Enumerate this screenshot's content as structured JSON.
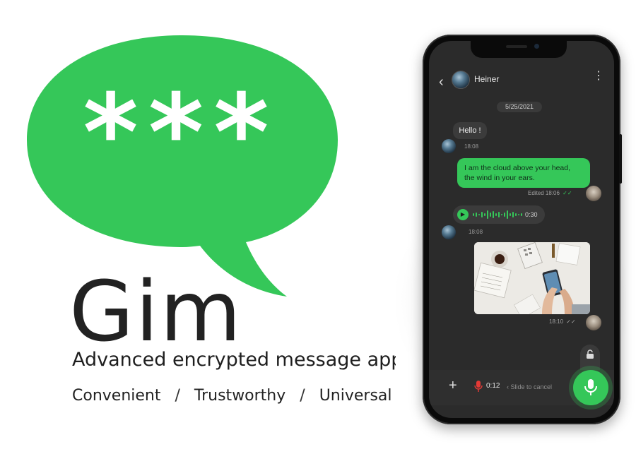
{
  "brand": {
    "logo_text": "***",
    "name": "Gim",
    "tagline": "Advanced encrypted message app",
    "features": [
      "Convenient",
      "Trustworthy",
      "Universal"
    ],
    "separator": "/",
    "accent_color": "#35C759"
  },
  "chat": {
    "header": {
      "contact_name": "Heiner",
      "back_icon": "chevron-left-icon",
      "menu_icon": "more-vertical-icon"
    },
    "date_divider": "5/25/2021",
    "messages": [
      {
        "direction": "in",
        "type": "text",
        "text": "Hello !",
        "time": "18:08"
      },
      {
        "direction": "out",
        "type": "text",
        "lines": [
          "I am the cloud above your head,",
          "the wind in your ears."
        ],
        "status": "Edited 18:06"
      },
      {
        "direction": "in",
        "type": "voice",
        "duration": "0:30",
        "time": "18:08"
      },
      {
        "direction": "out",
        "type": "image",
        "time": "18:10"
      }
    ],
    "composer": {
      "add_icon": "plus-icon",
      "recording_time": "0:12",
      "slide_hint": "Slide to cancel",
      "mic_icon": "microphone-icon",
      "lock_icon": "lock-icon"
    }
  }
}
